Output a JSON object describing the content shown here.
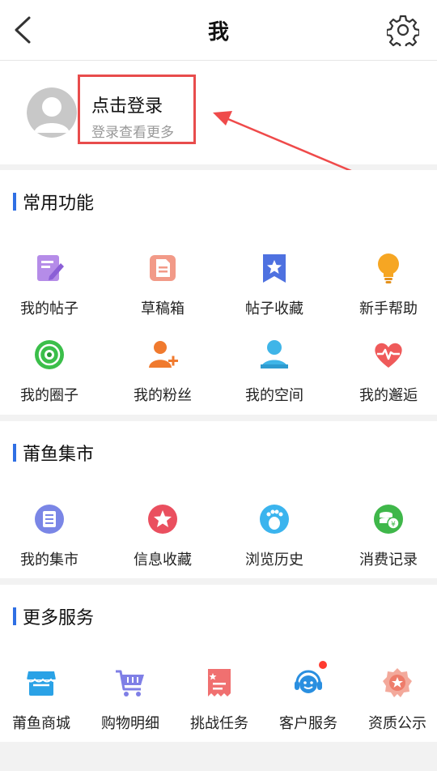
{
  "header": {
    "title": "我"
  },
  "profile": {
    "login_title": "点击登录",
    "login_subtitle": "登录查看更多"
  },
  "sections": [
    {
      "title": "常用功能",
      "items": [
        {
          "label": "我的帖子",
          "icon": "post-edit-icon"
        },
        {
          "label": "草稿箱",
          "icon": "draft-icon"
        },
        {
          "label": "帖子收藏",
          "icon": "bookmark-star-icon"
        },
        {
          "label": "新手帮助",
          "icon": "lightbulb-icon"
        },
        {
          "label": "我的圈子",
          "icon": "circle-target-icon"
        },
        {
          "label": "我的粉丝",
          "icon": "user-add-icon"
        },
        {
          "label": "我的空间",
          "icon": "user-space-icon"
        },
        {
          "label": "我的邂逅",
          "icon": "heart-pulse-icon"
        }
      ]
    },
    {
      "title": "莆鱼集市",
      "items": [
        {
          "label": "我的集市",
          "icon": "list-icon"
        },
        {
          "label": "信息收藏",
          "icon": "star-icon"
        },
        {
          "label": "浏览历史",
          "icon": "footprint-icon"
        },
        {
          "label": "消费记录",
          "icon": "coins-icon"
        }
      ]
    },
    {
      "title": "更多服务",
      "items": [
        {
          "label": "莆鱼商城",
          "icon": "store-icon"
        },
        {
          "label": "购物明细",
          "icon": "cart-icon"
        },
        {
          "label": "挑战任务",
          "icon": "task-icon"
        },
        {
          "label": "客户服务",
          "icon": "customer-service-icon",
          "badge": true
        },
        {
          "label": "资质公示",
          "icon": "certificate-icon"
        }
      ]
    }
  ],
  "colors": {
    "accent": "#2f6fe4",
    "highlight_border": "#e84c4c",
    "badge": "#ff3b30"
  }
}
